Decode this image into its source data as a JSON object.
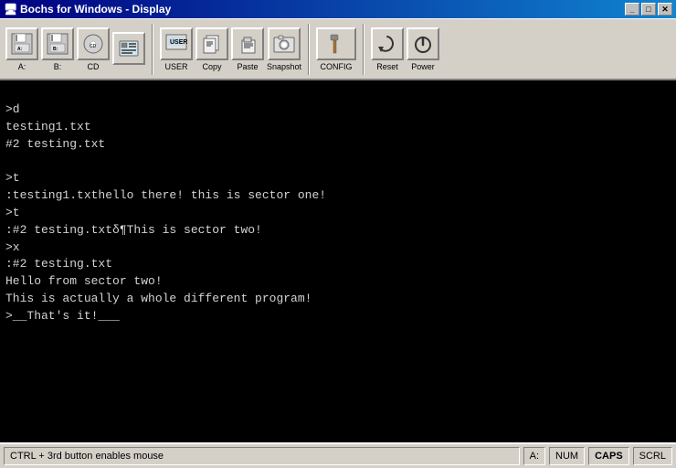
{
  "window": {
    "title": "Bochs for Windows - Display",
    "title_icon": "●"
  },
  "title_controls": {
    "minimize": "_",
    "maximize": "□",
    "close": "✕"
  },
  "toolbar": {
    "groups": [
      {
        "items": [
          {
            "label": "A:",
            "icon": "floppy_a"
          },
          {
            "label": "B:",
            "icon": "floppy_b"
          },
          {
            "label": "CD",
            "icon": "cd"
          },
          {
            "label": "",
            "icon": "config"
          }
        ]
      },
      {
        "items": [
          {
            "label": "USER",
            "icon": "user"
          },
          {
            "label": "Copy",
            "icon": "copy"
          },
          {
            "label": "Paste",
            "icon": "paste"
          },
          {
            "label": "Snapshot",
            "icon": "snapshot"
          }
        ]
      },
      {
        "items": [
          {
            "label": "CONFIG",
            "icon": "config2"
          }
        ]
      },
      {
        "items": [
          {
            "label": "Reset",
            "icon": "reset"
          },
          {
            "label": "Power",
            "icon": "power"
          }
        ]
      }
    ]
  },
  "terminal": {
    "lines": [
      "",
      ">d",
      "testing1.txt",
      "#2 testing.txt",
      "",
      ">t",
      ":testing1.txthello there! this is sector one!",
      ">t",
      ":#2 testing.txtδ¶This is sector two!",
      ">x",
      ":#2 testing.txt",
      "Hello from sector two!",
      "This is actually a whole different program!",
      ">__That's it!___"
    ]
  },
  "status_bar": {
    "main_text": "CTRL + 3rd button enables mouse",
    "a_label": "A:",
    "num_label": "NUM",
    "caps_label": "CAPS",
    "scrl_label": "SCRL"
  }
}
